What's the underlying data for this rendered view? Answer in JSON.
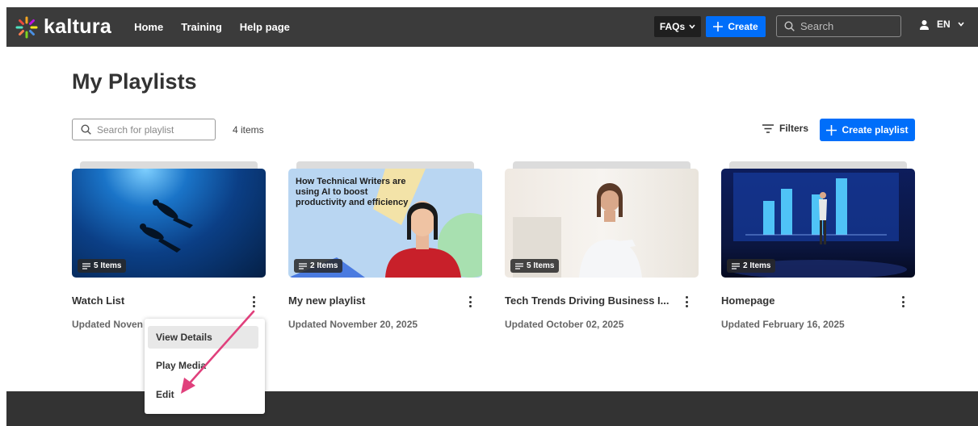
{
  "brand": {
    "name": "kaltura"
  },
  "nav": {
    "links": [
      "Home",
      "Training",
      "Help page"
    ],
    "faqs_label": "FAQs",
    "create_label": "Create"
  },
  "search": {
    "placeholder": "Search"
  },
  "user": {
    "language": "EN"
  },
  "page": {
    "title": "My Playlists",
    "search_placeholder": "Search for playlist",
    "items_count": "4 items",
    "filters_label": "Filters",
    "create_playlist_label": "Create playlist"
  },
  "cards": [
    {
      "title": "Watch List",
      "items": "5 Items",
      "updated": "Updated Noven"
    },
    {
      "title": "My new playlist",
      "items": "2 Items",
      "updated": "Updated November 20, 2025",
      "thumb_text": "How Technical Writers are using AI to boost productivity and efficiency"
    },
    {
      "title": "Tech Trends Driving Business I...",
      "items": "5 Items",
      "updated": "Updated October 02, 2025"
    },
    {
      "title": "Homepage",
      "items": "2 Items",
      "updated": "Updated February 16, 2025"
    }
  ],
  "menu": {
    "items": [
      "View Details",
      "Play Media",
      "Edit"
    ]
  },
  "colors": {
    "accent": "#006efa",
    "topbar": "#3b3b3b",
    "arrow": "#e0407c"
  }
}
